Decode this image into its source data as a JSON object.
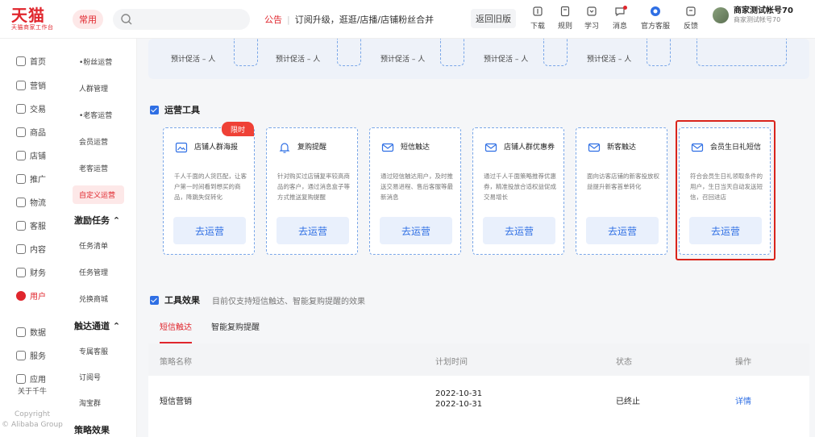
{
  "header": {
    "logo_main": "天猫",
    "logo_sub": "天猫商家工作台",
    "common_label": "常用",
    "search_placeholder": "",
    "announce_tag": "公告",
    "announce_text": "订阅升级，逛逛/店播/店铺粉丝合并",
    "old_version_label": "返回旧版",
    "tools": [
      {
        "label": "下载",
        "icon": "download-icon"
      },
      {
        "label": "规则",
        "icon": "rules-icon"
      },
      {
        "label": "学习",
        "icon": "learn-icon"
      },
      {
        "label": "消息",
        "icon": "message-icon"
      },
      {
        "label": "官方客服",
        "icon": "service-icon"
      },
      {
        "label": "反馈",
        "icon": "feedback-icon"
      }
    ],
    "user_name": "商家测试帐号70",
    "user_sub": "商家测试帐号70"
  },
  "leftnav": {
    "items": [
      {
        "label": "首页",
        "icon": "home-icon"
      },
      {
        "label": "营销",
        "icon": "marketing-icon"
      },
      {
        "label": "交易",
        "icon": "trade-icon"
      },
      {
        "label": "商品",
        "icon": "goods-icon"
      },
      {
        "label": "店铺",
        "icon": "store-icon"
      },
      {
        "label": "推广",
        "icon": "promote-icon"
      },
      {
        "label": "物流",
        "icon": "logistics-icon"
      },
      {
        "label": "客服",
        "icon": "customer-service-icon"
      },
      {
        "label": "内容",
        "icon": "content-icon"
      },
      {
        "label": "财务",
        "icon": "finance-icon"
      },
      {
        "label": "用户",
        "icon": "user-icon"
      },
      {
        "label": "数据",
        "icon": "data-icon"
      },
      {
        "label": "服务",
        "icon": "services-icon"
      },
      {
        "label": "应用",
        "icon": "apps-icon"
      }
    ],
    "about": "关于千牛",
    "copyright": "Copyright",
    "company": "© Alibaba Group"
  },
  "subnav": {
    "items": [
      "•粉丝运营",
      "人群管理",
      "•老客运营",
      "会员运营",
      "老客运营",
      "自定义运营"
    ],
    "group_incentive": "激励任务",
    "incentive_items": [
      "任务清单",
      "任务管理",
      "兑换商城"
    ],
    "group_reach": "触达通道",
    "reach_items": [
      "专属客服",
      "订阅号",
      "淘宝群"
    ],
    "group_effect": "策略效果"
  },
  "promo": {
    "labels": [
      "预计促活 – 人",
      "预计促活 – 人",
      "预计促活 – 人",
      "预计促活 – 人",
      "预计促活 – 人"
    ]
  },
  "tools_section": {
    "title": "运营工具",
    "cards": [
      {
        "title": "店铺人群海报",
        "desc": "千人千面的人货匹配，让客户第一时间看到想买的商品，降跳失促转化",
        "button": "去运营",
        "badge": "限时",
        "icon": "poster-icon"
      },
      {
        "title": "复购提醒",
        "desc": "针对购买过店铺复率较高商品的客户，通过消息盒子等方式推送复购提醒",
        "button": "去运营",
        "badge": "",
        "icon": "bell-icon"
      },
      {
        "title": "短信触达",
        "desc": "通过短信触达用户，及时推送交易进程、售后客服等最新消息",
        "button": "去运营",
        "badge": "",
        "icon": "mail-icon"
      },
      {
        "title": "店铺人群优惠券",
        "desc": "通过千人千面策略推荐优惠券，精准投放合适权益促成交易增长",
        "button": "去运营",
        "badge": "",
        "icon": "coupon-icon"
      },
      {
        "title": "新客触达",
        "desc": "面向访客店铺的新客投放权益提升新客首单转化",
        "button": "去运营",
        "badge": "",
        "icon": "mail-icon"
      },
      {
        "title": "会员生日礼短信",
        "desc": "符合会员生日礼领取条件的用户，生日当天自动发送短信，召回进店",
        "button": "去运营",
        "badge": "",
        "icon": "mail-icon"
      }
    ]
  },
  "effects_section": {
    "title": "工具效果",
    "note": "目前仅支持短信触达、智能复购提醒的效果",
    "tabs": [
      "短信触达",
      "智能复购提醒"
    ],
    "columns": [
      "策略名称",
      "计划时间",
      "状态",
      "操作"
    ],
    "rows": [
      {
        "name": "短信营销",
        "time_start": "2022-10-31",
        "time_end": "2022-10-31",
        "status": "已终止",
        "action": "详情"
      }
    ]
  },
  "colors": {
    "brand_red": "#e0262d",
    "link_blue": "#2f6fe4"
  }
}
